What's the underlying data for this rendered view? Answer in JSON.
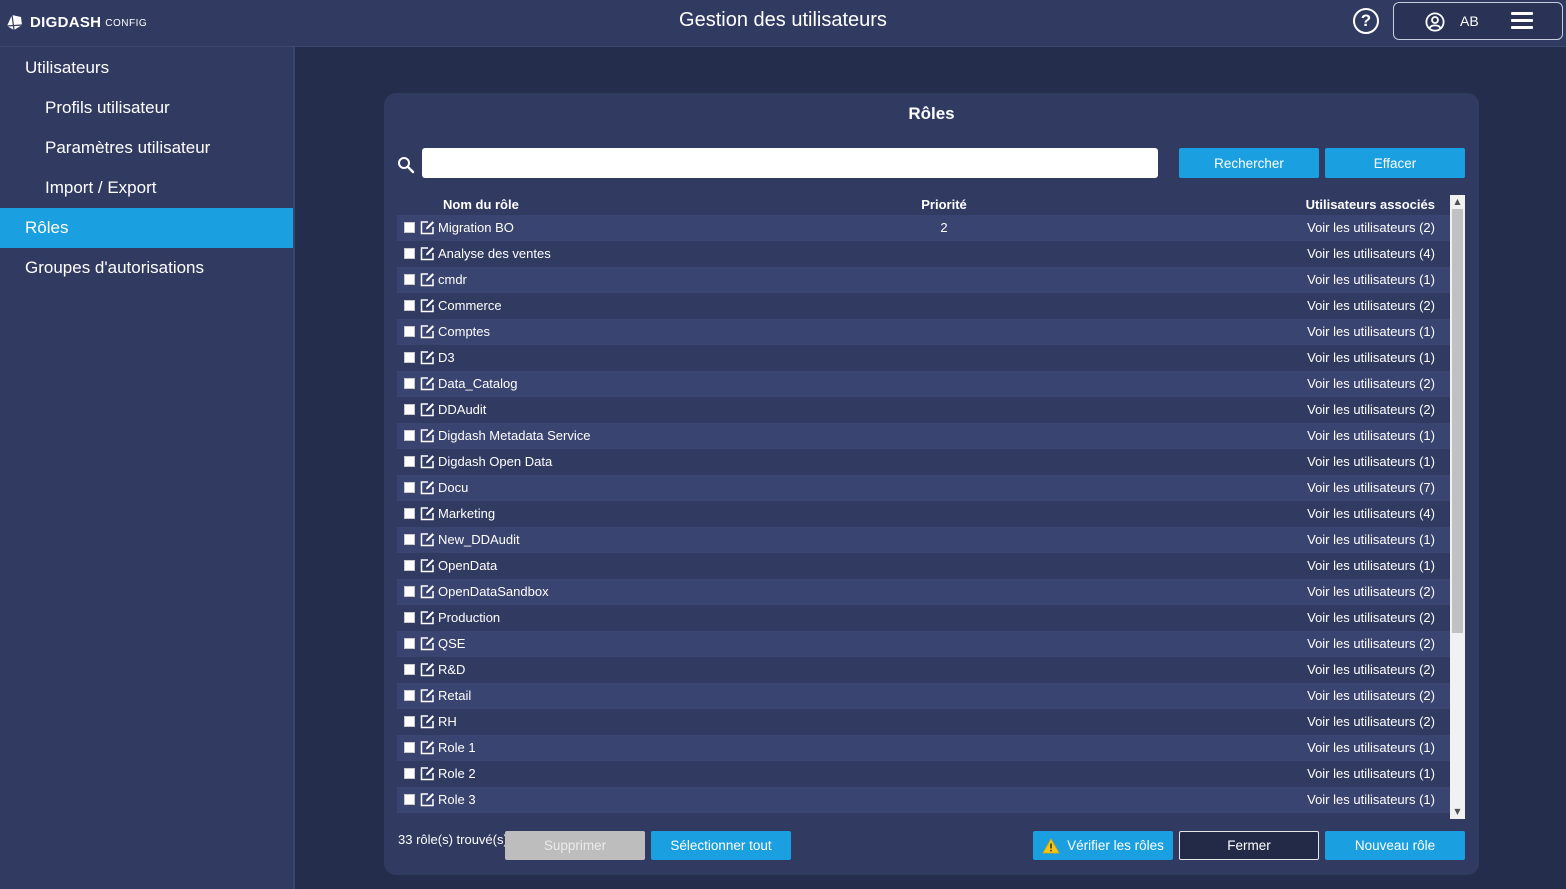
{
  "app": {
    "logo_text": "DIGDASH",
    "logo_sub": "CONFIG",
    "page_title": "Gestion des utilisateurs",
    "help_label": "?",
    "user_initials": "AB"
  },
  "sidebar": {
    "items": [
      {
        "label": "Utilisateurs"
      },
      {
        "label": "Profils utilisateur"
      },
      {
        "label": "Paramètres utilisateur"
      },
      {
        "label": "Import / Export"
      },
      {
        "label": "Rôles"
      },
      {
        "label": "Groupes d'autorisations"
      }
    ]
  },
  "panel": {
    "title": "Rôles",
    "search": {
      "value": "",
      "placeholder": ""
    },
    "search_button": "Rechercher",
    "clear_button": "Effacer",
    "columns": {
      "name": "Nom du rôle",
      "priority": "Priorité",
      "users": "Utilisateurs associés"
    },
    "rows": [
      {
        "name": "Migration BO",
        "priority": "2",
        "users": "Voir les utilisateurs (2)"
      },
      {
        "name": "Analyse des ventes",
        "priority": "",
        "users": "Voir les utilisateurs (4)"
      },
      {
        "name": "cmdr",
        "priority": "",
        "users": "Voir les utilisateurs (1)"
      },
      {
        "name": "Commerce",
        "priority": "",
        "users": "Voir les utilisateurs (2)"
      },
      {
        "name": "Comptes",
        "priority": "",
        "users": "Voir les utilisateurs (1)"
      },
      {
        "name": "D3",
        "priority": "",
        "users": "Voir les utilisateurs (1)"
      },
      {
        "name": "Data_Catalog",
        "priority": "",
        "users": "Voir les utilisateurs (2)"
      },
      {
        "name": "DDAudit",
        "priority": "",
        "users": "Voir les utilisateurs (2)"
      },
      {
        "name": "Digdash Metadata Service",
        "priority": "",
        "users": "Voir les utilisateurs (1)"
      },
      {
        "name": "Digdash Open Data",
        "priority": "",
        "users": "Voir les utilisateurs (1)"
      },
      {
        "name": "Docu",
        "priority": "",
        "users": "Voir les utilisateurs (7)"
      },
      {
        "name": "Marketing",
        "priority": "",
        "users": "Voir les utilisateurs (4)"
      },
      {
        "name": "New_DDAudit",
        "priority": "",
        "users": "Voir les utilisateurs (1)"
      },
      {
        "name": "OpenData",
        "priority": "",
        "users": "Voir les utilisateurs (1)"
      },
      {
        "name": "OpenDataSandbox",
        "priority": "",
        "users": "Voir les utilisateurs (2)"
      },
      {
        "name": "Production",
        "priority": "",
        "users": "Voir les utilisateurs (2)"
      },
      {
        "name": "QSE",
        "priority": "",
        "users": "Voir les utilisateurs (2)"
      },
      {
        "name": "R&D",
        "priority": "",
        "users": "Voir les utilisateurs (2)"
      },
      {
        "name": "Retail",
        "priority": "",
        "users": "Voir les utilisateurs (2)"
      },
      {
        "name": "RH",
        "priority": "",
        "users": "Voir les utilisateurs (2)"
      },
      {
        "name": "Role 1",
        "priority": "",
        "users": "Voir les utilisateurs (1)"
      },
      {
        "name": "Role 2",
        "priority": "",
        "users": "Voir les utilisateurs (1)"
      },
      {
        "name": "Role 3",
        "priority": "",
        "users": "Voir les utilisateurs (1)"
      }
    ],
    "found_text": "33 rôle(s) trouvé(s)",
    "delete_button": "Supprimer",
    "select_all_button": "Sélectionner tout",
    "verify_button": "Vérifier les rôles",
    "close_button": "Fermer",
    "new_button": "Nouveau rôle"
  },
  "colors": {
    "accent": "#1a9fe0",
    "background": "#252d4d",
    "panel": "#313b62",
    "row_alt": "#3a4470",
    "warning": "#f5c518"
  },
  "icons": [
    "digdash-logo-icon",
    "help-icon",
    "user-icon",
    "menu-icon",
    "search-icon",
    "edit-icon",
    "warning-icon"
  ]
}
